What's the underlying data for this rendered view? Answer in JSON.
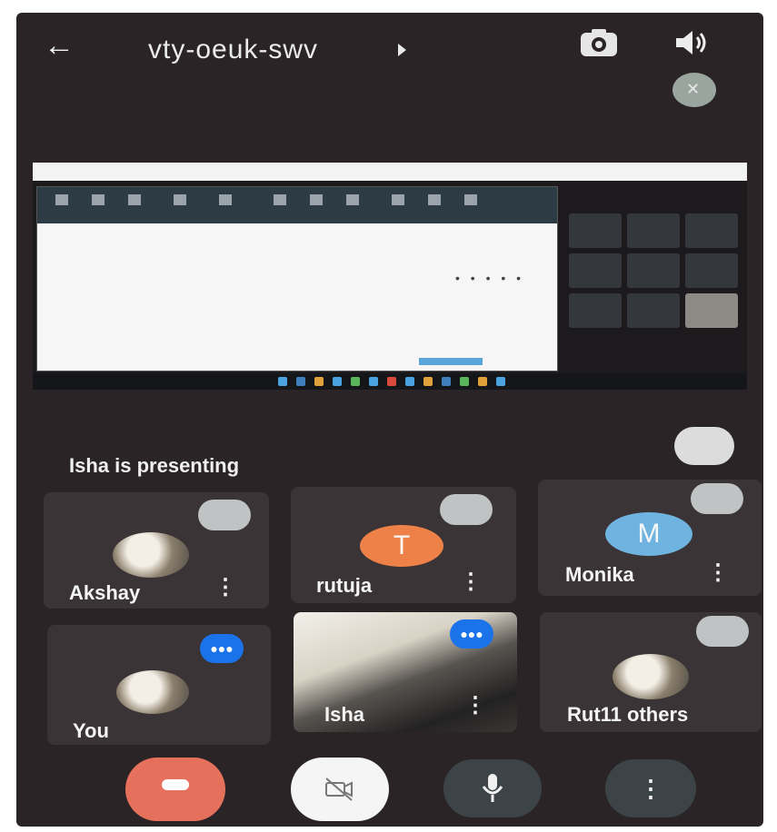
{
  "header": {
    "back_icon": "arrow-left-icon",
    "meeting_code": "vty-oeuk-swv",
    "flip_camera_icon": "flip-camera-icon",
    "speaker_icon": "speaker-icon"
  },
  "presenting_text": "Isha is presenting",
  "participants": [
    {
      "name": "Akshay",
      "avatar": "photo"
    },
    {
      "name": "rutuja",
      "avatar_letter": "T",
      "avatar_color": "#ee8148"
    },
    {
      "name": "Monika",
      "avatar_letter": "M",
      "avatar_color": "#6fb3e0"
    },
    {
      "name": "You",
      "avatar": "photo"
    },
    {
      "name": "Isha",
      "avatar": "video"
    },
    {
      "name": "Rut11 others",
      "avatar": "photo"
    }
  ],
  "more_glyph": "⋮",
  "controls": {
    "end_call_icon": "phone-hangup-icon",
    "camera_icon": "camera-off-icon",
    "mic_icon": "mic-icon",
    "more_icon": "more-vert-icon"
  },
  "colors": {
    "background": "#2a2426",
    "end_call": "#e5715c",
    "speaking": "#1a73e8"
  }
}
